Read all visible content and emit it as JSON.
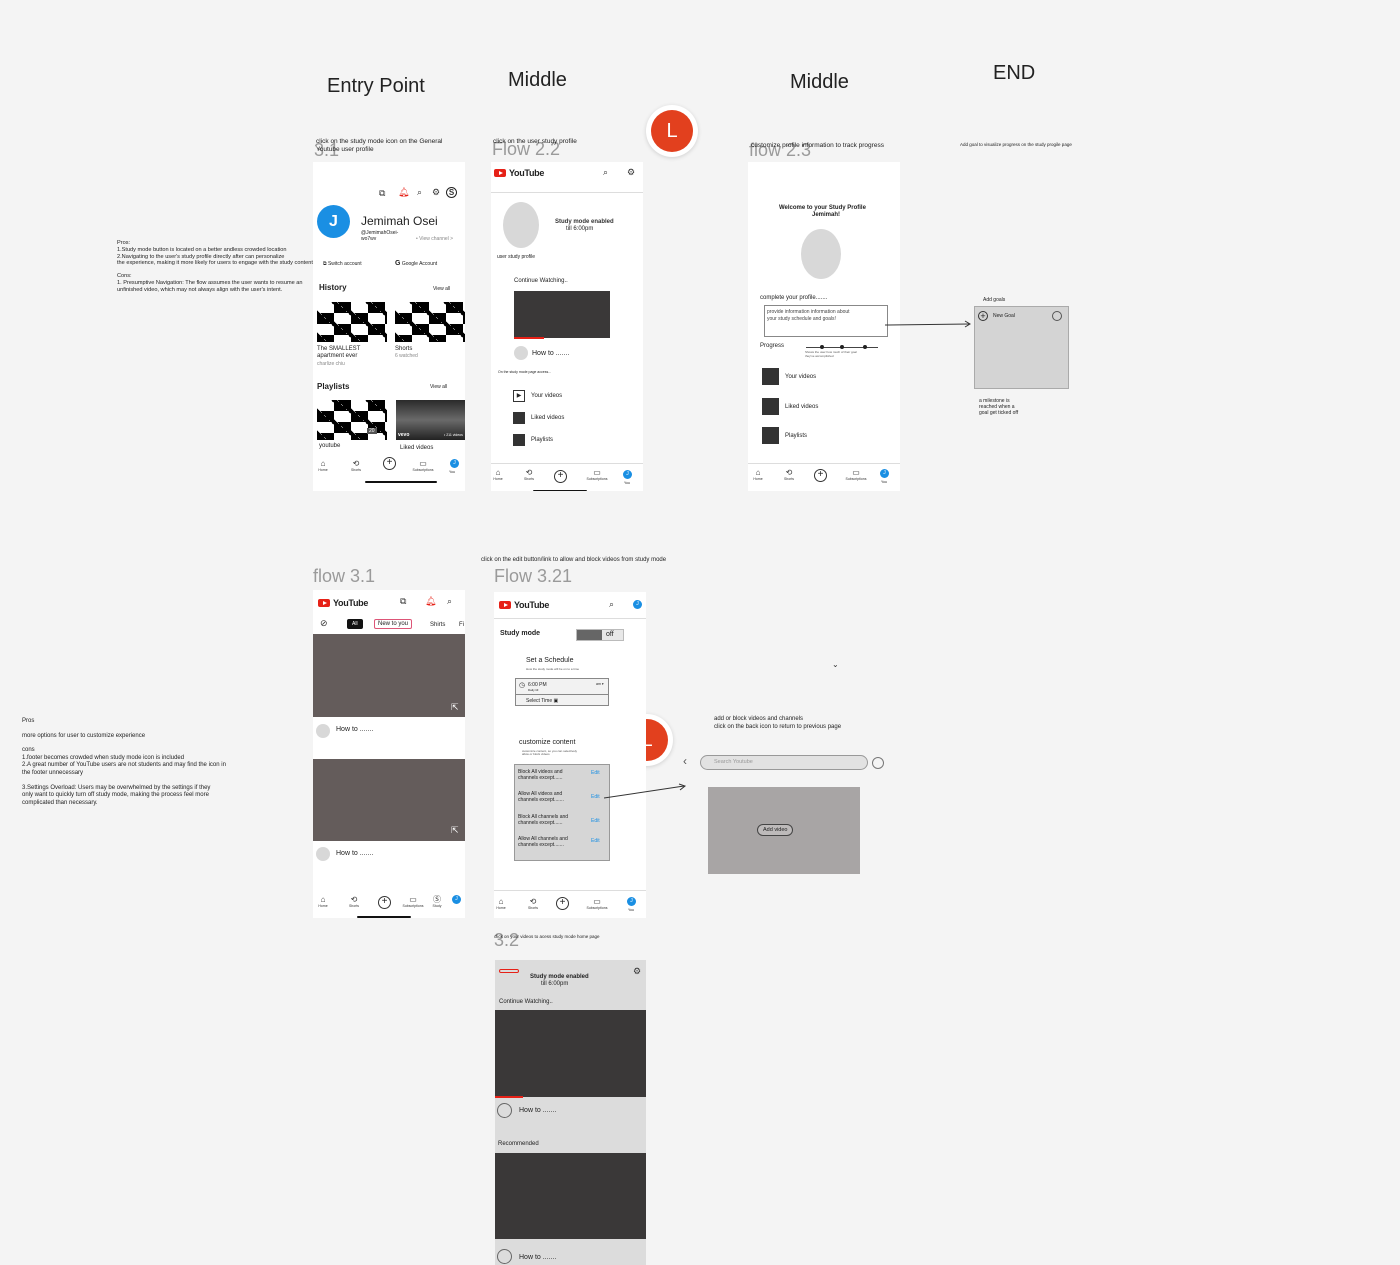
{
  "columns": {
    "entry": "Entry Point",
    "middle1": "Middle",
    "middle2": "Middle",
    "end": "END"
  },
  "flows": {
    "f31_top": "3.1",
    "f22": "Flow 2.2",
    "f23": "flow 2.3",
    "f31": "flow 3.1",
    "f321": "Flow 3.21",
    "f32": "3.2"
  },
  "captions": {
    "c1": "click on the study mode icon on the General Youtube user profile",
    "c2": "click on the user study profile",
    "c3": "customize profile information to track progress",
    "c4": "Add goal to visualize progress on the study progile page",
    "c5": "click on the edit button/link to allow and block videos from study mode",
    "c6": "click on your videos to acess study mode home page"
  },
  "notes": {
    "n1": [
      "Pros:",
      "1.Study mode button is located on a better andless crowded location",
      "2.Navigating to the user's study profile directly after can personalize",
      "  the experience, making it more likely for users to engage with the study content.",
      "",
      "Cons:",
      " 1. Presumptive Navigation: The flow assumes the user wants to resume an",
      " unfinished video, which may not always align with the user's intent."
    ],
    "n2": [
      "Pros",
      "",
      "more options for user to customize experience",
      "",
      "cons",
      "1.footer becomes crowded when study mode icon is included",
      "2.A great number of YouTube  users are not students and may find the icon in",
      "the footer unnecessary",
      "",
      "3.Settings Overload: Users may be overwhelmed by the settings if they",
      "only want to quickly turn off study mode, making the process feel more",
      "complicated than necessary."
    ],
    "n3": [
      "add or block videos  and channels",
      "click on the back icon to return to previous page"
    ],
    "n4": [
      "a milestone is",
      "reached when a",
      "goal get ticked off"
    ]
  },
  "avatar_letter": "L",
  "youtube": "YouTube",
  "footer": {
    "home": "Home",
    "shorts": "Shorts",
    "subs": "Subscriptions",
    "you": "You",
    "study": "Study"
  },
  "p1": {
    "avatar": "J",
    "name": "Jemimah Osei",
    "handle": "@JemimahOsei-",
    "handle2": "wo7wv",
    "view_channel": "• View channel >",
    "switch": "Switch account",
    "google": "Google Account",
    "history": "History",
    "view_all": "View all",
    "h1a": "The SMALLEST",
    "h1b": "apartment ever",
    "h1c": "charlize chiu",
    "h2a": "Shorts",
    "h2b": "6 watched",
    "playlists": "Playlists",
    "pl1": "youtube",
    "pl2": "Liked videos",
    "vevo": "vevo",
    "count": "20",
    "count2": "• 211 videos"
  },
  "p2": {
    "enabled": "Study mode enabled",
    "till": "till 6:00pm",
    "profile": "user study profile",
    "continue": "Continue Watching..",
    "howto": "How to .......",
    "note": "On the study mode page access...",
    "your_videos": "Your videos",
    "liked": "Liked videos",
    "playlists": "Playlists"
  },
  "p3": {
    "welcome": "Welcome to your Study Profile",
    "name": "Jemimah!",
    "complete": "complete your profile.......",
    "info1": "provide information information about",
    "info2": "your study schedule and goals!",
    "progress": "Progress",
    "pnote1": "Shows the user how much of their goal",
    "pnote2": "they've accomplished",
    "your_videos": "Your videos",
    "liked": "Liked videos",
    "playlists": "Playlists"
  },
  "goal": {
    "label": "Add goals",
    "new": "New Goal"
  },
  "p4": {
    "all": "All",
    "new": "New to you",
    "shirts": "Shirts",
    "fi": "Fi",
    "howto": "How to ......."
  },
  "p5": {
    "study": "Study  mode",
    "off": "off",
    "schedule": "Set a Schedule",
    "sched_note": "How the study mode will be on to a time",
    "time": "6:00 PM",
    "time_sub": "Daily till",
    "ampm": "am ▾",
    "select": "Select Time",
    "customize": "customize content",
    "cnote1": "customize content, so you can selectively",
    "cnote2": "allow or block videos",
    "r1a": "Block All videos and",
    "r1b": "channels except......",
    "r2a": "Allow All videos and",
    "r2b": "channels except.......",
    "r3a": "Block All channels and",
    "r3b": "channels except......",
    "r4a": "Allow All channels and",
    "r4b": "channels except.......",
    "edit": "Edit"
  },
  "search": {
    "placeholder": "Search Youtube",
    "add": "Add video"
  },
  "p6": {
    "enabled": "Study mode enabled",
    "till": "till 6:00pm",
    "continue": "Continue Watching..",
    "howto": "How to .......",
    "recommended": "Recommended"
  }
}
